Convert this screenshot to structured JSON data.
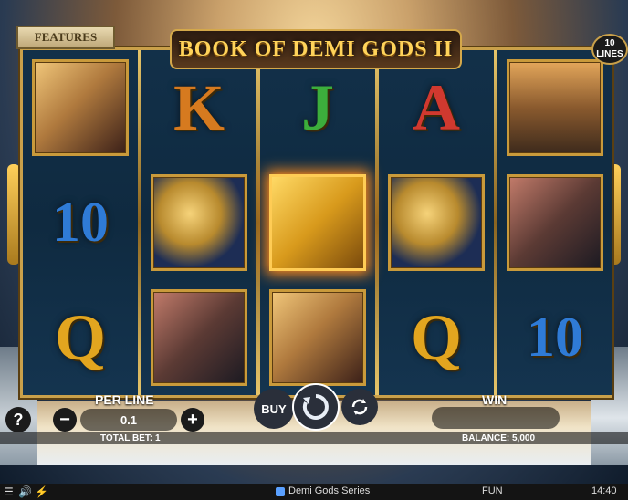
{
  "game": {
    "title": "BOOK OF DEMI GODS II",
    "features_label": "FEATURES",
    "lines_count": "10",
    "lines_label": "LINES"
  },
  "reels": [
    {
      "symbols": [
        {
          "type": "image",
          "name": "demigoddess"
        },
        {
          "type": "text",
          "text": "10",
          "color": "#2f7bd6"
        },
        {
          "type": "text",
          "text": "Q",
          "color": "#e2a51f"
        }
      ]
    },
    {
      "symbols": [
        {
          "type": "text",
          "text": "K",
          "color": "#d67a1f"
        },
        {
          "type": "image",
          "name": "winged-helmet"
        },
        {
          "type": "image",
          "name": "demigod-warrior"
        }
      ]
    },
    {
      "symbols": [
        {
          "type": "text",
          "text": "J",
          "color": "#3cae3c"
        },
        {
          "type": "image",
          "name": "golden-book"
        },
        {
          "type": "image",
          "name": "demigoddess"
        }
      ]
    },
    {
      "symbols": [
        {
          "type": "text",
          "text": "A",
          "color": "#d0392f"
        },
        {
          "type": "image",
          "name": "winged-helmet"
        },
        {
          "type": "text",
          "text": "Q",
          "color": "#e2a51f"
        }
      ]
    },
    {
      "symbols": [
        {
          "type": "image",
          "name": "castle"
        },
        {
          "type": "image",
          "name": "demigod-warrior"
        },
        {
          "type": "text",
          "text": "10",
          "color": "#2f7bd6"
        }
      ]
    }
  ],
  "controls": {
    "help_label": "?",
    "per_line_label": "PER LINE",
    "per_line_value": "0.1",
    "minus_label": "−",
    "plus_label": "+",
    "buy_label": "BUY",
    "win_label": "WIN",
    "win_value": "",
    "total_bet_text": "TOTAL BET: 1",
    "balance_text": "BALANCE: 5,000"
  },
  "status_bar": {
    "series_name": "Demi Gods Series",
    "mode": "FUN",
    "time": "14:40"
  },
  "colors": {
    "gold": "#c9a04a",
    "reel_bg": "#0f2a40"
  }
}
